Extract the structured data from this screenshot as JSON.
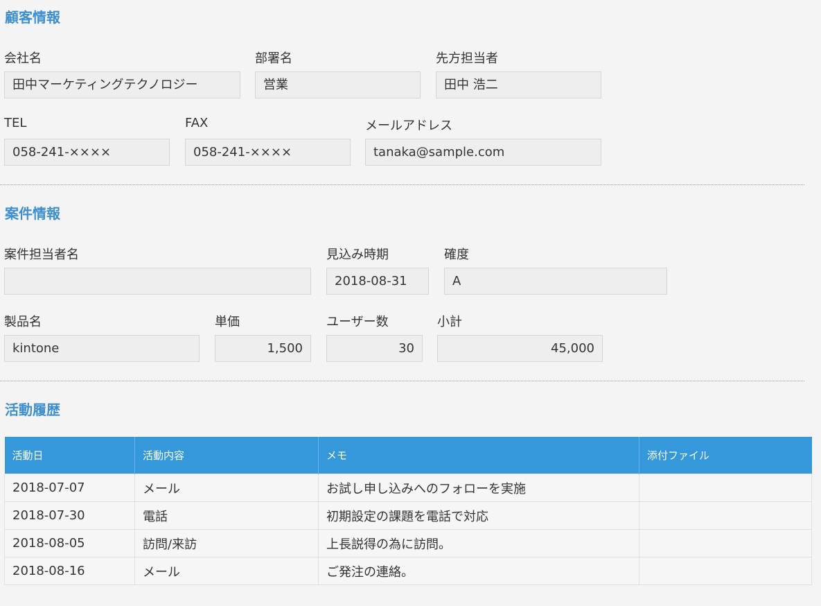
{
  "customer": {
    "title": "顧客情報",
    "company": {
      "label": "会社名",
      "value": "田中マーケティングテクノロジー"
    },
    "department": {
      "label": "部署名",
      "value": "営業"
    },
    "contact": {
      "label": "先方担当者",
      "value": "田中 浩二"
    },
    "tel": {
      "label": "TEL",
      "value": "058-241-××××"
    },
    "fax": {
      "label": "FAX",
      "value": "058-241-××××"
    },
    "email": {
      "label": "メールアドレス",
      "value": "tanaka@sample.com"
    }
  },
  "deal": {
    "title": "案件情報",
    "owner": {
      "label": "案件担当者名",
      "value": ""
    },
    "expected_date": {
      "label": "見込み時期",
      "value": "2018-08-31"
    },
    "certainty": {
      "label": "確度",
      "value": "A"
    },
    "product": {
      "label": "製品名",
      "value": "kintone"
    },
    "unit_price": {
      "label": "単価",
      "value": "1,500"
    },
    "users": {
      "label": "ユーザー数",
      "value": "30"
    },
    "subtotal": {
      "label": "小計",
      "value": "45,000"
    }
  },
  "activity": {
    "title": "活動履歴",
    "columns": [
      "活動日",
      "活動内容",
      "メモ",
      "添付ファイル"
    ],
    "rows": [
      {
        "date": "2018-07-07",
        "type": "メール",
        "memo": "お試し申し込みへのフォローを実施",
        "file": ""
      },
      {
        "date": "2018-07-30",
        "type": "電話",
        "memo": "初期設定の課題を電話で対応",
        "file": ""
      },
      {
        "date": "2018-08-05",
        "type": "訪問/来訪",
        "memo": "上長説得の為に訪問。",
        "file": ""
      },
      {
        "date": "2018-08-16",
        "type": "メール",
        "memo": "ご発注の連絡。",
        "file": ""
      }
    ]
  }
}
